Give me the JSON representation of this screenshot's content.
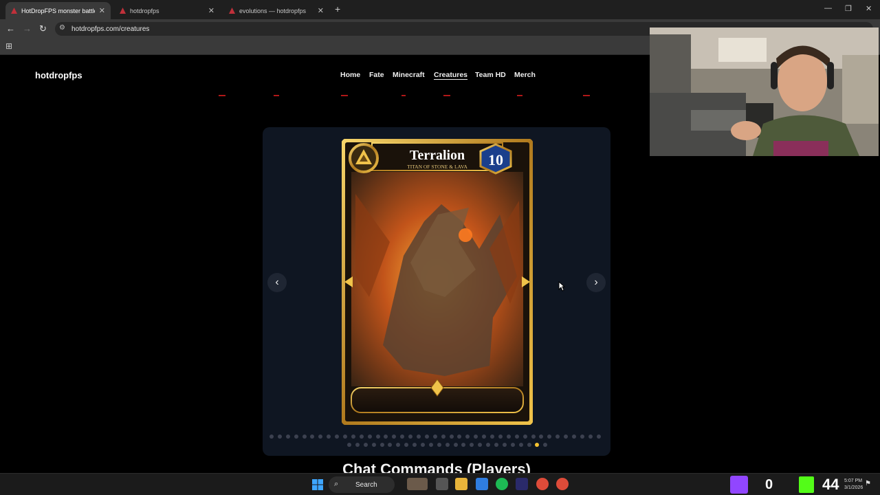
{
  "browser": {
    "tabs": [
      {
        "title": "HotDropFPS monster battle sty",
        "active": true
      },
      {
        "title": "hotdropfps",
        "active": false
      },
      {
        "title": "evolutions — hotdropfps",
        "active": false
      }
    ],
    "new_tab": "+",
    "url": "hotdropfps.com/creatures",
    "window_controls": {
      "minimize": "—",
      "maximize": "❐",
      "close": "✕"
    }
  },
  "site": {
    "brand": "hotdropfps",
    "nav": [
      {
        "label": "Home",
        "active": false
      },
      {
        "label": "Fate",
        "active": false
      },
      {
        "label": "Minecraft",
        "active": false
      },
      {
        "label": "Creatures",
        "active": true
      },
      {
        "label": "Team HD",
        "active": false
      },
      {
        "label": "Merch",
        "active": false
      }
    ]
  },
  "carousel": {
    "prev": "‹",
    "next": "›",
    "dots_total": 66,
    "dots_row1": 41,
    "active_dot": 64,
    "card": {
      "name": "Terralion",
      "subtitle": "TITAN OF STONE & LAVA",
      "level": "10"
    }
  },
  "section": {
    "heading": "Chat Commands (Players)"
  },
  "taskbar": {
    "search_label": "Search",
    "counter_left": "0",
    "counter_right": "44",
    "time": "5:07 PM",
    "date": "3/1/2026"
  },
  "colors": {
    "accent_gold": "#f5c230",
    "twitch": "#9146ff",
    "kick": "#53fc18"
  }
}
